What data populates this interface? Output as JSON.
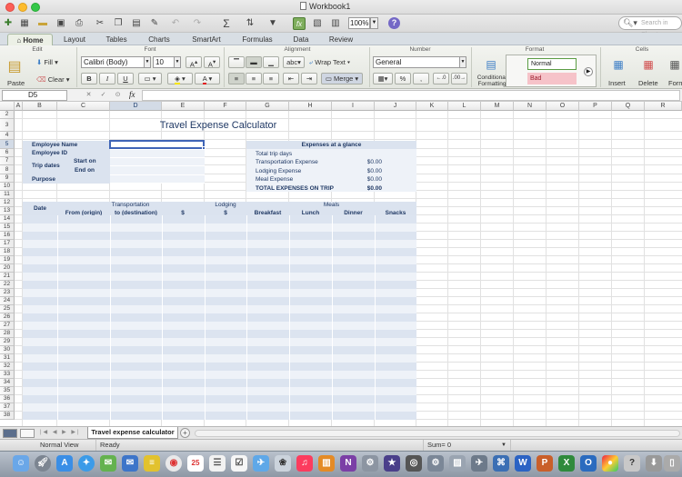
{
  "window": {
    "title": "Workbook1"
  },
  "toolbar": {
    "zoom": "100%",
    "search_placeholder": "Search in Sheet"
  },
  "ribbon_tabs": [
    "Home",
    "Layout",
    "Tables",
    "Charts",
    "SmartArt",
    "Formulas",
    "Data",
    "Review"
  ],
  "ribbon": {
    "groups": {
      "edit": "Edit",
      "font": "Font",
      "alignment": "Alignment",
      "number": "Number",
      "format": "Format",
      "cells": "Cells"
    },
    "paste": "Paste",
    "fill": "Fill",
    "clear": "Clear",
    "font_name": "Calibri (Body)",
    "font_size": "10",
    "bold": "B",
    "italic": "I",
    "underline": "U",
    "abc": "abc",
    "wrap_text": "Wrap Text",
    "merge": "Merge",
    "number_format": "General",
    "conditional_formatting": "Conditional Formatting",
    "style_normal": "Normal",
    "style_bad": "Bad",
    "insert": "Insert",
    "delete": "Delete",
    "format": "Form"
  },
  "formula_bar": {
    "cell_ref": "D5",
    "fx": "fx"
  },
  "columns": [
    "A",
    "B",
    "C",
    "D",
    "E",
    "F",
    "G",
    "H",
    "I",
    "J",
    "K",
    "L",
    "M",
    "N",
    "O",
    "P",
    "Q",
    "R"
  ],
  "rows": [
    "2",
    "3",
    "4",
    "5",
    "6",
    "7",
    "8",
    "9",
    "10",
    "11",
    "12",
    "13",
    "14",
    "15",
    "16",
    "17",
    "18",
    "19",
    "20",
    "21",
    "22",
    "23",
    "24",
    "25",
    "26",
    "27",
    "28",
    "29",
    "30",
    "31",
    "32",
    "33",
    "34",
    "35",
    "36",
    "37",
    "38"
  ],
  "sheet": {
    "title": "Travel Expense Calculator",
    "info_labels": {
      "employee_name": "Employee Name",
      "employee_id": "Employee ID",
      "trip_dates": "Trip dates",
      "start_on": "Start on",
      "end_on": "End on",
      "purpose": "Purpose"
    },
    "glance": {
      "header": "Expenses at a glance",
      "rows": [
        {
          "label": "Total trip days",
          "value": ""
        },
        {
          "label": "Transportation Expense",
          "value": "$0.00"
        },
        {
          "label": "Lodging Expense",
          "value": "$0.00"
        },
        {
          "label": "Meal Expense",
          "value": "$0.00"
        },
        {
          "label": "TOTAL EXPENSES ON TRIP",
          "value": "$0.00"
        }
      ]
    },
    "table_headers": {
      "date": "Date",
      "transportation": "Transportation",
      "lodging": "Lodging",
      "meals": "Meals",
      "from": "From (origin)",
      "to": "to (destination)",
      "dollar1": "$",
      "dollar2": "$",
      "breakfast": "Breakfast",
      "lunch": "Lunch",
      "dinner": "Dinner",
      "snacks": "Snacks"
    }
  },
  "sheet_tabs": {
    "active": "Travel expense calculator",
    "add": "+"
  },
  "status_bar": {
    "view": "Normal View",
    "state": "Ready",
    "sum": "Sum= 0"
  }
}
